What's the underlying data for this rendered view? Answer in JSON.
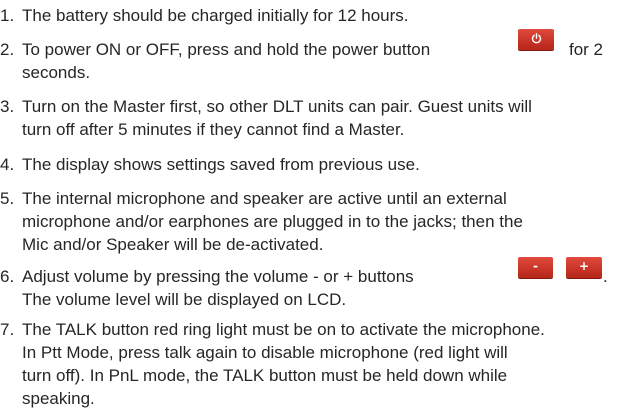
{
  "instructions": [
    {
      "number": "1.",
      "lines": [
        "The battery should be charged initially for 12 hours."
      ]
    },
    {
      "number": "2.",
      "lines": [
        "To power ON or OFF, press and hold the power button",
        "for 2",
        "seconds."
      ]
    },
    {
      "number": "3.",
      "lines": [
        "Turn on the Master first, so other DLT units can pair.  Guest units will",
        "turn off after 5 minutes if they cannot find a Master."
      ]
    },
    {
      "number": "4.",
      "lines": [
        "The display shows settings saved from previous use."
      ]
    },
    {
      "number": "5.",
      "lines": [
        "The internal microphone and speaker are active until an external",
        "microphone and/or earphones are plugged in to the jacks; then the",
        "Mic and/or Speaker will be de-activated."
      ]
    },
    {
      "number": "6.",
      "lines": [
        "Adjust volume by pressing the volume - or + buttons",
        ".",
        "The volume level will be displayed on LCD."
      ]
    },
    {
      "number": "7.",
      "lines": [
        "The TALK button red ring light must be on to activate the microphone.",
        "In Ptt Mode, press talk again to disable microphone (red light will",
        "turn off).  In PnL mode, the TALK button must be held down while",
        "speaking."
      ]
    }
  ],
  "buttons": {
    "power": {
      "icon": "power-icon",
      "color": "#cf3427"
    },
    "volume_down": {
      "label": "-",
      "color": "#cf3427"
    },
    "volume_up": {
      "label": "+",
      "color": "#cf3427"
    }
  }
}
